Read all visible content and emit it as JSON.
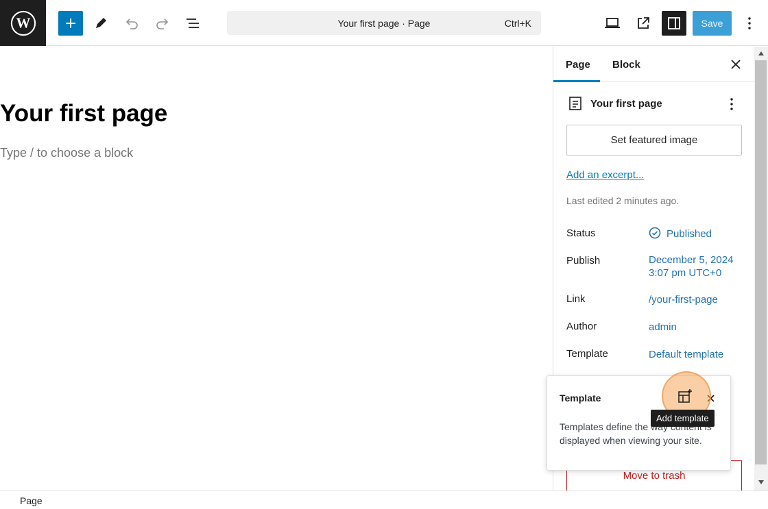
{
  "toolbar": {
    "command_title": "Your first page · Page",
    "command_shortcut": "Ctrl+K",
    "save_label": "Save",
    "icons": [
      "wordpress-logo",
      "plus-icon",
      "pencil-icon",
      "undo-icon",
      "redo-icon",
      "list-view-icon",
      "laptop-icon",
      "external-link-icon",
      "sidebar-icon",
      "kebab-icon"
    ]
  },
  "editor": {
    "title": "Your first page",
    "placeholder": "Type / to choose a block"
  },
  "sidebar": {
    "tabs": [
      {
        "label": "Page"
      },
      {
        "label": "Block"
      }
    ],
    "summary_title": "Your first page",
    "featured_image_label": "Set featured image",
    "excerpt_label": "Add an excerpt...",
    "last_edited": "Last edited 2 minutes ago.",
    "meta": [
      {
        "label": "Status",
        "value": "Published"
      },
      {
        "label": "Publish",
        "value_line1": "December 5, 2024",
        "value_line2": "3:07 pm UTC+0"
      },
      {
        "label": "Link",
        "value": "/your-first-page"
      },
      {
        "label": "Author",
        "value": "admin"
      },
      {
        "label": "Template",
        "value": "Default template"
      }
    ],
    "trash_label": "Move to trash"
  },
  "popover": {
    "title": "Template",
    "description": "Templates define the way content is displayed when viewing your site.",
    "tooltip": "Add template"
  },
  "footer": {
    "breadcrumb": "Page"
  },
  "colors": {
    "accent": "#007cba",
    "link": "#2271b1",
    "danger": "#cc1818",
    "highlight": "#f6a85c"
  }
}
